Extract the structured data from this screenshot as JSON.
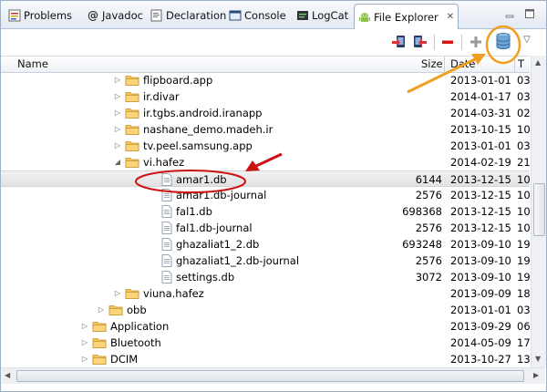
{
  "tabs": [
    {
      "label": "Problems",
      "icon": "problems-icon"
    },
    {
      "label": "Javadoc",
      "icon": "at-icon"
    },
    {
      "label": "Declaration",
      "icon": "declaration-icon"
    },
    {
      "label": "Console",
      "icon": "console-icon"
    },
    {
      "label": "LogCat",
      "icon": "logcat-icon"
    },
    {
      "label": "File Explorer",
      "icon": "android-icon",
      "active": true
    }
  ],
  "toolbar": {
    "buttons": [
      "pull-file-icon",
      "push-file-icon",
      "delete-icon",
      "new-folder-icon",
      "database-icon"
    ],
    "highlight_color": "#f0a020"
  },
  "columns": {
    "name": "Name",
    "size": "Size",
    "date": "Date",
    "time": "T"
  },
  "rows": [
    {
      "name": "flipboard.app",
      "size": "",
      "date": "2013-01-01",
      "time": "03",
      "type": "folder",
      "indent": 1,
      "expanded": false
    },
    {
      "name": "ir.divar",
      "size": "",
      "date": "2014-01-17",
      "time": "03",
      "type": "folder",
      "indent": 1,
      "expanded": false
    },
    {
      "name": "ir.tgbs.android.iranapp",
      "size": "",
      "date": "2014-03-31",
      "time": "02",
      "type": "folder",
      "indent": 1,
      "expanded": false
    },
    {
      "name": "nashane_demo.madeh.ir",
      "size": "",
      "date": "2013-10-15",
      "time": "10",
      "type": "folder",
      "indent": 1,
      "expanded": false
    },
    {
      "name": "tv.peel.samsung.app",
      "size": "",
      "date": "2013-01-01",
      "time": "03",
      "type": "folder",
      "indent": 1,
      "expanded": false
    },
    {
      "name": "vi.hafez",
      "size": "",
      "date": "2014-02-19",
      "time": "21",
      "type": "folder",
      "indent": 1,
      "expanded": true
    },
    {
      "name": "amar1.db",
      "size": "6144",
      "date": "2013-12-15",
      "time": "10",
      "type": "file",
      "indent": 2,
      "selected": true
    },
    {
      "name": "amar1.db-journal",
      "size": "2576",
      "date": "2013-12-15",
      "time": "10",
      "type": "file",
      "indent": 2
    },
    {
      "name": "fal1.db",
      "size": "698368",
      "date": "2013-12-15",
      "time": "10",
      "type": "file",
      "indent": 2
    },
    {
      "name": "fal1.db-journal",
      "size": "2576",
      "date": "2013-12-15",
      "time": "10",
      "type": "file",
      "indent": 2
    },
    {
      "name": "ghazaliat1_2.db",
      "size": "693248",
      "date": "2013-09-10",
      "time": "19",
      "type": "file",
      "indent": 2
    },
    {
      "name": "ghazaliat1_2.db-journal",
      "size": "2576",
      "date": "2013-09-10",
      "time": "19",
      "type": "file",
      "indent": 2
    },
    {
      "name": "settings.db",
      "size": "3072",
      "date": "2013-09-10",
      "time": "19",
      "type": "file",
      "indent": 2
    },
    {
      "name": "viuna.hafez",
      "size": "",
      "date": "2013-09-09",
      "time": "18",
      "type": "folder",
      "indent": 1,
      "expanded": false
    },
    {
      "name": "obb",
      "size": "",
      "date": "2013-01-01",
      "time": "03",
      "type": "folder",
      "indent": 0.5,
      "expanded": false
    },
    {
      "name": "Application",
      "size": "",
      "date": "2013-09-29",
      "time": "06",
      "type": "folder",
      "indent": 0,
      "expanded": false
    },
    {
      "name": "Bluetooth",
      "size": "",
      "date": "2014-05-09",
      "time": "17",
      "type": "folder",
      "indent": 0,
      "expanded": false
    },
    {
      "name": "DCIM",
      "size": "",
      "date": "2013-10-27",
      "time": "13",
      "type": "folder",
      "indent": 0,
      "expanded": false
    }
  ],
  "annotations": {
    "circle_color": "#cc1111",
    "arrow_color": "#cc1111",
    "orange_color": "#f0a020"
  }
}
